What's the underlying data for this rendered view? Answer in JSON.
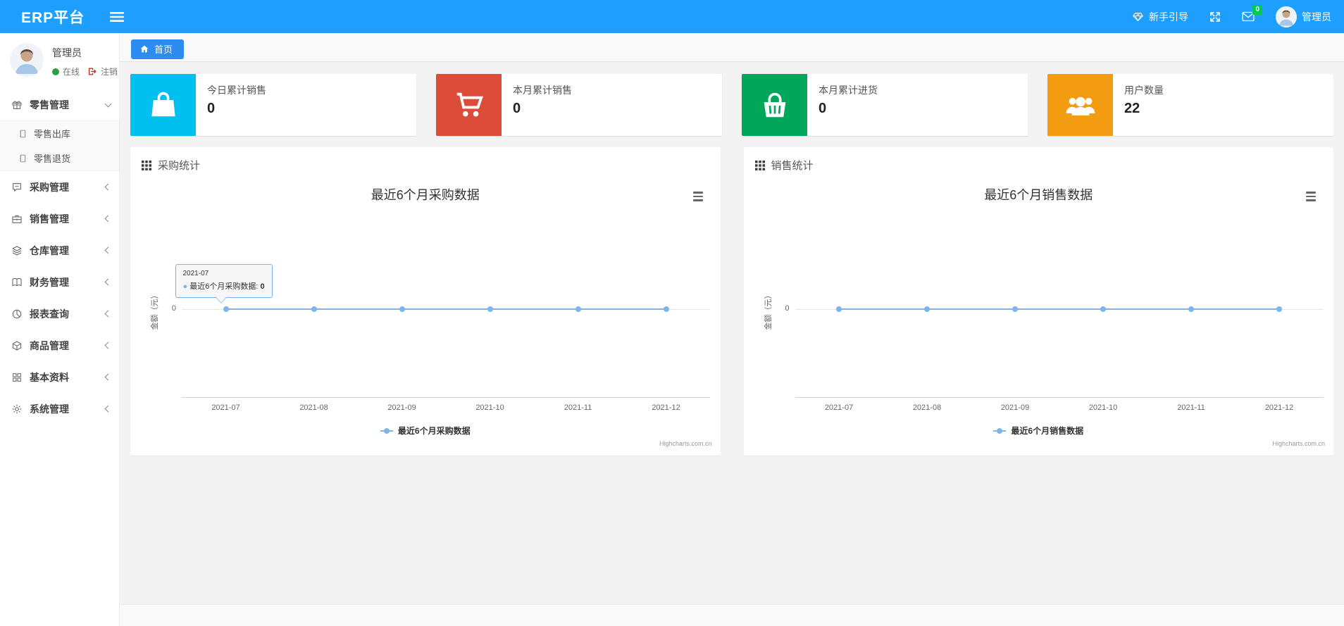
{
  "navbar": {
    "brand": "ERP平台",
    "guide_label": "新手引导",
    "message_badge": "0",
    "username": "管理员",
    "bg_color": "#1e9fff",
    "badge_color": "#00c853"
  },
  "sidebar": {
    "user": {
      "name": "管理员",
      "status": "在线",
      "logout": "注销"
    },
    "menu": [
      {
        "label": "零售管理",
        "icon": "gift-icon",
        "expanded": true,
        "children": [
          {
            "label": "零售出库"
          },
          {
            "label": "零售退货"
          }
        ]
      },
      {
        "label": "采购管理",
        "icon": "chat-icon"
      },
      {
        "label": "销售管理",
        "icon": "briefcase-icon"
      },
      {
        "label": "仓库管理",
        "icon": "layers-icon"
      },
      {
        "label": "财务管理",
        "icon": "book-icon"
      },
      {
        "label": "报表查询",
        "icon": "pie-chart-icon"
      },
      {
        "label": "商品管理",
        "icon": "box-icon"
      },
      {
        "label": "基本资料",
        "icon": "grid-icon"
      },
      {
        "label": "系统管理",
        "icon": "gear-icon"
      }
    ]
  },
  "tabs": {
    "home": "首页"
  },
  "stat_cards": [
    {
      "label": "今日累计销售",
      "value": "0",
      "color": "#00c0ef",
      "icon": "bag-icon"
    },
    {
      "label": "本月累计销售",
      "value": "0",
      "color": "#dd4b39",
      "icon": "cart-icon"
    },
    {
      "label": "本月累计进货",
      "value": "0",
      "color": "#00a65a",
      "icon": "basket-icon"
    },
    {
      "label": "用户数量",
      "value": "22",
      "color": "#f39c12",
      "icon": "users-icon"
    }
  ],
  "chart_data": [
    {
      "type": "line",
      "panel_title": "采购统计",
      "title": "最近6个月采购数据",
      "categories": [
        "2021-07",
        "2021-08",
        "2021-09",
        "2021-10",
        "2021-11",
        "2021-12"
      ],
      "series": [
        {
          "name": "最近6个月采购数据",
          "values": [
            0,
            0,
            0,
            0,
            0,
            0
          ],
          "color": "#7cb5ec"
        }
      ],
      "ylabel": "金额（元）",
      "ytick": "0",
      "ylim": [
        -1,
        1
      ],
      "grid": true,
      "legend_position": "bottom",
      "credit": "Highcharts.com.cn",
      "tooltip": {
        "header": "2021-07",
        "series": "最近6个月采购数据",
        "value": "0",
        "point_index": 0
      }
    },
    {
      "type": "line",
      "panel_title": "销售统计",
      "title": "最近6个月销售数据",
      "categories": [
        "2021-07",
        "2021-08",
        "2021-09",
        "2021-10",
        "2021-11",
        "2021-12"
      ],
      "series": [
        {
          "name": "最近6个月销售数据",
          "values": [
            0,
            0,
            0,
            0,
            0,
            0
          ],
          "color": "#7cb5ec"
        }
      ],
      "ylabel": "金额（元）",
      "ytick": "0",
      "ylim": [
        -1,
        1
      ],
      "grid": true,
      "legend_position": "bottom",
      "credit": "Highcharts.com.cn",
      "tooltip": null
    }
  ]
}
